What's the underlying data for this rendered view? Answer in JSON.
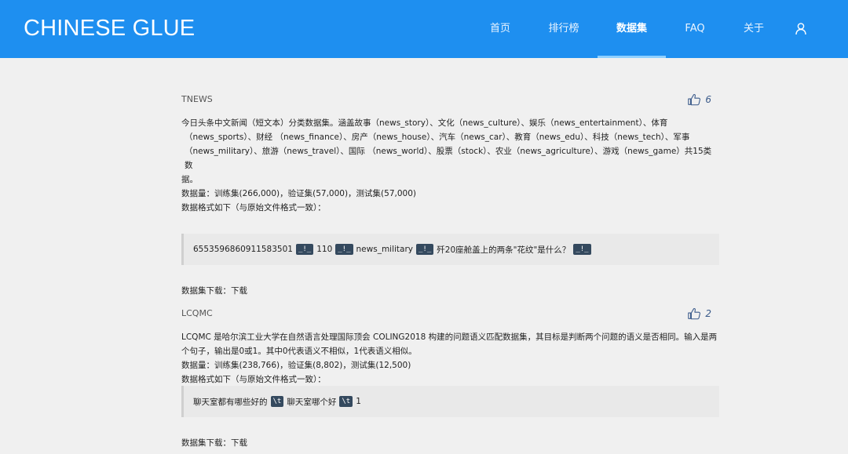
{
  "header": {
    "logo": "CHINESE GLUE",
    "nav": [
      "首页",
      "排行榜",
      "数据集",
      "FAQ",
      "关于"
    ],
    "active": "数据集",
    "user_icon": "user-icon",
    "colors": {
      "bar": "#1e8ff0",
      "underline": "#8fd0ff"
    }
  },
  "datasets": [
    {
      "name": "TNEWS",
      "likes": "6",
      "desc_lines": [
        "今日头条中文新闻（短文本）分类数据集。涵盖故事（news_story）、文化（news_culture）、娱乐（news_entertainment）、体育",
        "（news_sports）、财经 （news_finance）、房产（news_house）、汽车（news_car）、教育（news_edu）、科技（news_tech）、军事",
        "（news_military）、旅游（news_travel）、国际 （news_world）、股票（stock）、农业（news_agriculture）、游戏（news_game）共15类数",
        "据。"
      ],
      "stats": "数据量：训练集(266,000)，验证集(57,000)，测试集(57,000)",
      "format_note": "数据格式如下（与原始文件格式一致）：",
      "sample": {
        "parts": [
          "6553596860911583501",
          "110",
          "news_military",
          "歼20座舱盖上的两条\"花纹\"是什么？",
          ""
        ],
        "separator": "_!_"
      },
      "download_label": "数据集下载：",
      "download_link": "下载"
    },
    {
      "name": "LCQMC",
      "likes": "2",
      "desc_lines": [
        "LCQMC 是哈尔滨工业大学在自然语言处理国际顶会 COLING2018 构建的问题语义匹配数据集，其目标是判断两个问题的语义是否相同。输入是两",
        "个句子，输出是0或1。其中0代表语义不相似，1代表语义相似。"
      ],
      "stats": "数据量：训练集(238,766)，验证集(8,802)，测试集(12,500)",
      "format_note": "数据格式如下（与原始文件格式一致）：",
      "sample": {
        "parts": [
          "聊天室都有哪些好的",
          "聊天室哪个好",
          "1"
        ],
        "separator": "\\t"
      },
      "download_label": "数据集下载：",
      "download_link": "下载"
    }
  ]
}
